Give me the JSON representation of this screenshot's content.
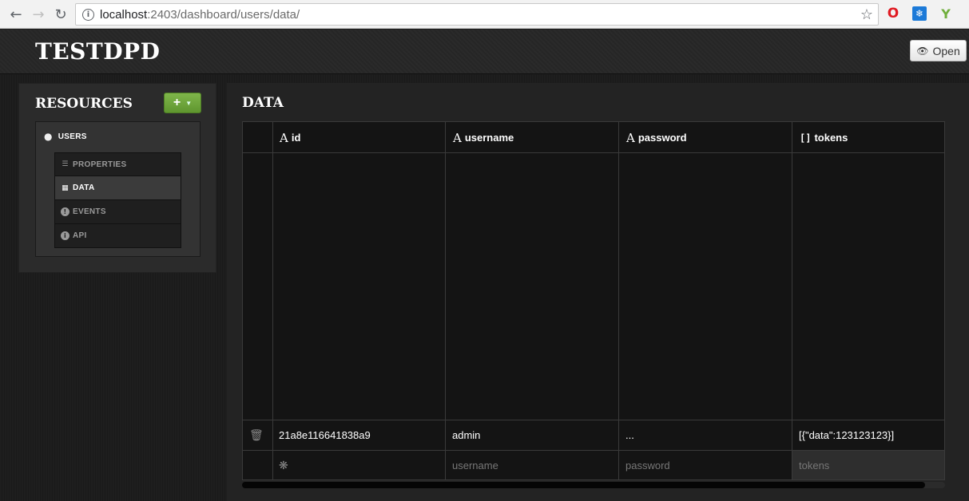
{
  "browser": {
    "url_host": "localhost",
    "url_path": ":2403/dashboard/users/data/",
    "back_icon": "arrow-left",
    "forward_icon": "arrow-right",
    "reload_icon": "reload",
    "info_icon": "i",
    "bookmark_icon": "star"
  },
  "header": {
    "title": "TESTDPD",
    "open_label": "Open"
  },
  "resources": {
    "title": "RESOURCES",
    "add_label": "+",
    "collection": "USERS",
    "items": [
      {
        "label": "PROPERTIES",
        "icon": "list-icon"
      },
      {
        "label": "DATA",
        "icon": "table-icon",
        "active": true
      },
      {
        "label": "EVENTS",
        "icon": "exclamation-icon"
      },
      {
        "label": "API",
        "icon": "info-icon"
      }
    ]
  },
  "data": {
    "title": "DATA",
    "columns": [
      {
        "type": "A",
        "name": "id"
      },
      {
        "type": "A",
        "name": "username"
      },
      {
        "type": "A",
        "name": "password"
      },
      {
        "type": "[]",
        "name": "tokens"
      }
    ],
    "rows": [
      {
        "id": "21a8e116641838a9",
        "username": "admin",
        "password": "...",
        "tokens": "[{\"data\":123123123}]"
      }
    ],
    "new_row": {
      "username_placeholder": "username",
      "password_placeholder": "password",
      "tokens_placeholder": "tokens"
    }
  },
  "colors": {
    "accent_green": "#6fa83c",
    "panel_bg": "#2b2b2b",
    "grid_bg": "#141414"
  }
}
